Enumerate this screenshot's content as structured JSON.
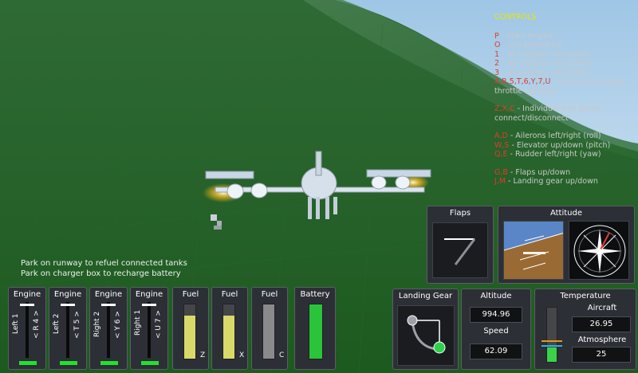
{
  "controls": {
    "title": "CONTROLS",
    "items": [
      {
        "key": "P",
        "desc": " - Start engine"
      },
      {
        "key": "O",
        "desc": " - Cut engine off"
      },
      {
        "key": "1",
        "desc": " - All engines min power"
      },
      {
        "key": "2",
        "desc": " - All engines mid power"
      },
      {
        "key": "3",
        "desc": " - All engines full power"
      },
      {
        "key": "4,R,5,T,6,Y,7,U",
        "desc": " - Individual engine throttle up/down"
      },
      {
        "key": "Z,X,C",
        "desc": " - Individual fuel tanks connect/disconnect"
      },
      {
        "key": "A,D",
        "desc": " - Ailerons left/right (roll)"
      },
      {
        "key": "W,S",
        "desc": " - Elevator up/down (pitch)"
      },
      {
        "key": "Q,E",
        "desc": " - Rudder left/right (yaw)"
      },
      {
        "key": "G,B",
        "desc": " - Flaps up/down"
      },
      {
        "key": "J,M",
        "desc": " - Landing gear up/down"
      }
    ]
  },
  "hints": {
    "refuel": "Park on runway to refuel connected tanks",
    "recharge": "Park on charger box to recharge battery"
  },
  "engines": [
    {
      "title": "Engine",
      "name": "Left 1",
      "keys": "< R 4 >",
      "throttle": 0.95
    },
    {
      "title": "Engine",
      "name": "Left 2",
      "keys": "< T 5 >",
      "throttle": 0.95
    },
    {
      "title": "Engine",
      "name": "Right 2",
      "keys": "< Y 6 >",
      "throttle": 0.95
    },
    {
      "title": "Engine",
      "name": "Right 1",
      "keys": "< U 7 >",
      "throttle": 0.95
    }
  ],
  "fuel": [
    {
      "title": "Fuel",
      "key": "Z",
      "level": 0.8,
      "color": "#d9d96a"
    },
    {
      "title": "Fuel",
      "key": "X",
      "level": 0.8,
      "color": "#d9d96a"
    },
    {
      "title": "Fuel",
      "key": "C",
      "level": 1.0,
      "color": "#8a8a8a"
    }
  ],
  "battery": {
    "title": "Battery",
    "level": 1.0,
    "color": "#2ac43a"
  },
  "flaps": {
    "title": "Flaps"
  },
  "attitude": {
    "title": "Attitude"
  },
  "landing_gear": {
    "title": "Landing Gear"
  },
  "altitude": {
    "title": "Altitude",
    "value": "994.96"
  },
  "speed": {
    "title": "Speed",
    "value": "62.09"
  },
  "temperature": {
    "title": "Temperature",
    "aircraft_label": "Aircraft",
    "aircraft_value": "26.95",
    "atmosphere_label": "Atmosphere",
    "atmosphere_value": "25"
  }
}
